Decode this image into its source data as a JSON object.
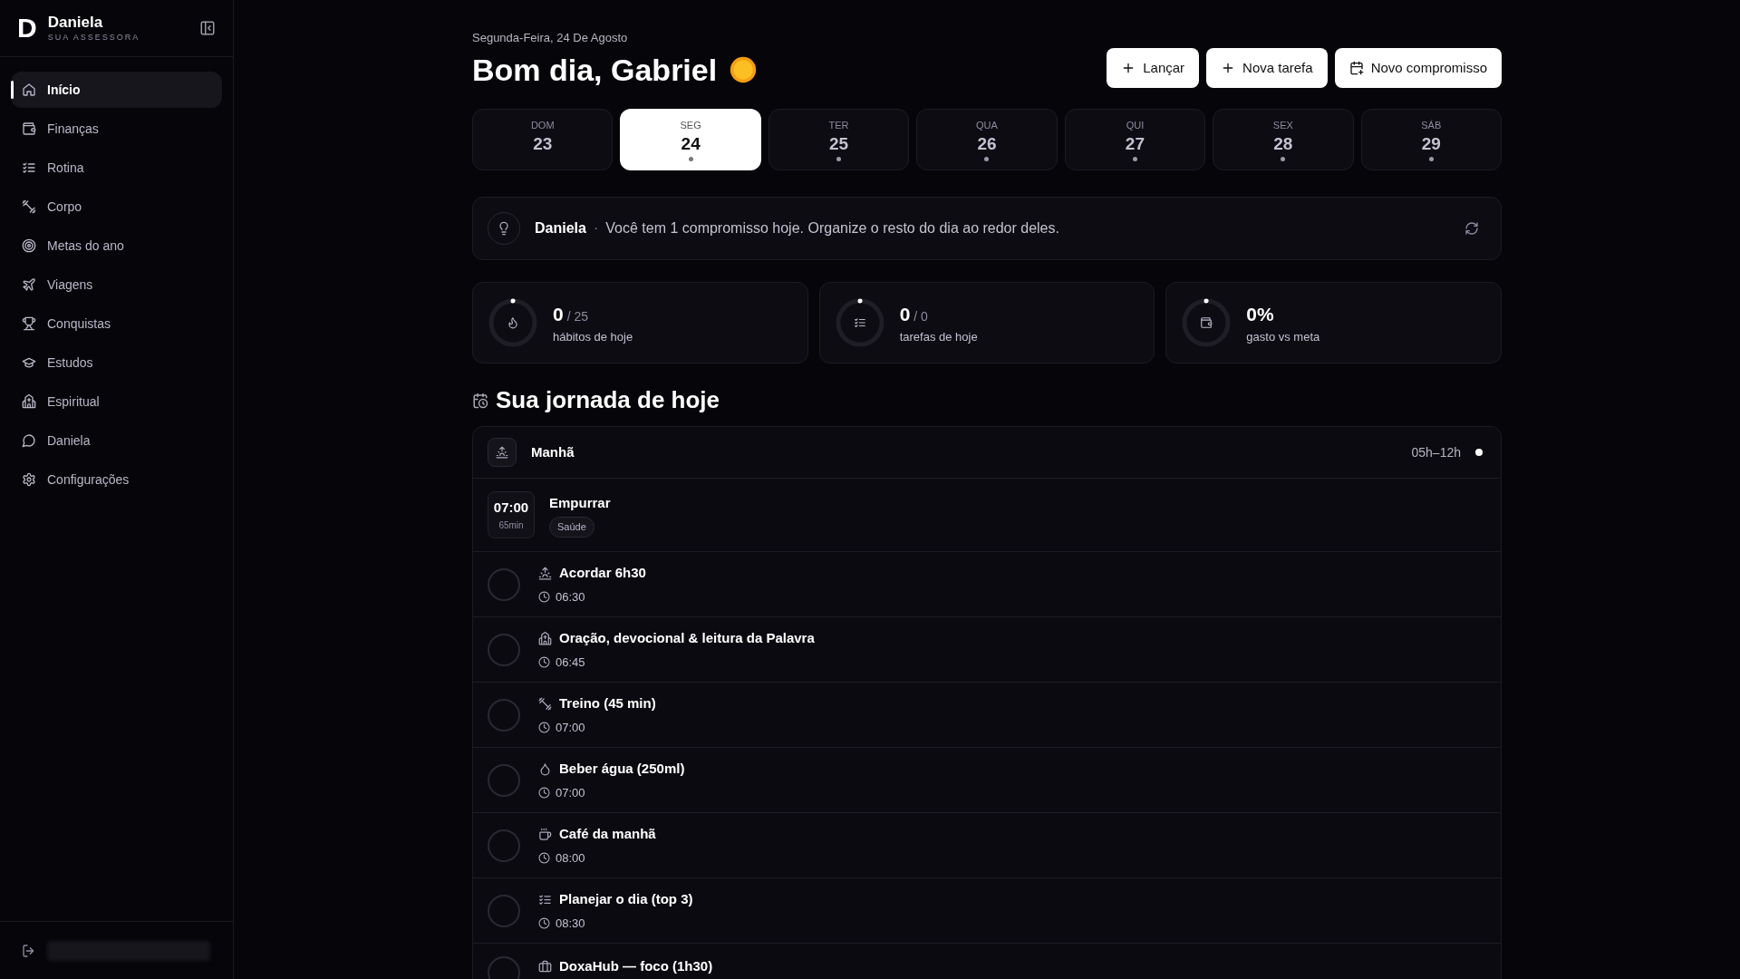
{
  "sidebar": {
    "brand": {
      "letter": "D",
      "name": "Daniela",
      "tagline": "SUA ASSESSORA"
    },
    "items": [
      {
        "label": "Início",
        "selected": true
      },
      {
        "label": "Finanças",
        "selected": false
      },
      {
        "label": "Rotina",
        "selected": false
      },
      {
        "label": "Corpo",
        "selected": false
      },
      {
        "label": "Metas do ano",
        "selected": false
      },
      {
        "label": "Viagens",
        "selected": false
      },
      {
        "label": "Conquistas",
        "selected": false
      },
      {
        "label": "Estudos",
        "selected": false
      },
      {
        "label": "Espiritual",
        "selected": false
      },
      {
        "label": "Daniela",
        "selected": false
      },
      {
        "label": "Configurações",
        "selected": false
      }
    ]
  },
  "header": {
    "date": "Segunda-Feira, 24 De Agosto",
    "greeting": "Bom dia, Gabriel",
    "buttons": [
      "Lançar",
      "Nova tarefa",
      "Novo compromisso"
    ]
  },
  "days": [
    {
      "weekday": "DOM",
      "day": "23",
      "selected": false,
      "marked": false
    },
    {
      "weekday": "SEG",
      "day": "24",
      "selected": true,
      "marked": true
    },
    {
      "weekday": "TER",
      "day": "25",
      "selected": false,
      "marked": true
    },
    {
      "weekday": "QUA",
      "day": "26",
      "selected": false,
      "marked": true
    },
    {
      "weekday": "QUI",
      "day": "27",
      "selected": false,
      "marked": true
    },
    {
      "weekday": "SEX",
      "day": "28",
      "selected": false,
      "marked": true
    },
    {
      "weekday": "SÁB",
      "day": "29",
      "selected": false,
      "marked": true
    }
  ],
  "assistant": {
    "name": "Daniela",
    "separator": "·",
    "message": "Você tem 1 compromisso hoje. Organize o resto do dia ao redor deles."
  },
  "stats": [
    {
      "value": "0",
      "total": "/ 25",
      "label": "hábitos de hoje",
      "level": 0
    },
    {
      "value": "0",
      "total": "/ 0",
      "label": "tarefas de hoje",
      "level": 0
    },
    {
      "value": "0%",
      "label": "gasto vs meta",
      "level": 0
    }
  ],
  "journey": {
    "title": "Sua jornada de hoje",
    "period": {
      "name": "Manhã",
      "range": "05h–12h"
    },
    "event": {
      "time": "07:00",
      "duration": "65min",
      "title": "Empurrar",
      "tag": "Saúde"
    },
    "habits": [
      {
        "title": "Acordar 6h30",
        "time": "06:30",
        "checked": false
      },
      {
        "title": "Oração, devocional & leitura da Palavra",
        "time": "06:45",
        "checked": false
      },
      {
        "title": "Treino (45 min)",
        "time": "07:00",
        "checked": false
      },
      {
        "title": "Beber água (250ml)",
        "time": "07:00",
        "checked": false
      },
      {
        "title": "Café da manhã",
        "time": "08:00",
        "checked": false
      },
      {
        "title": "Planejar o dia (top 3)",
        "time": "08:30",
        "checked": false
      },
      {
        "title": "DoxaHub — foco (1h30)",
        "checked": false
      }
    ]
  }
}
